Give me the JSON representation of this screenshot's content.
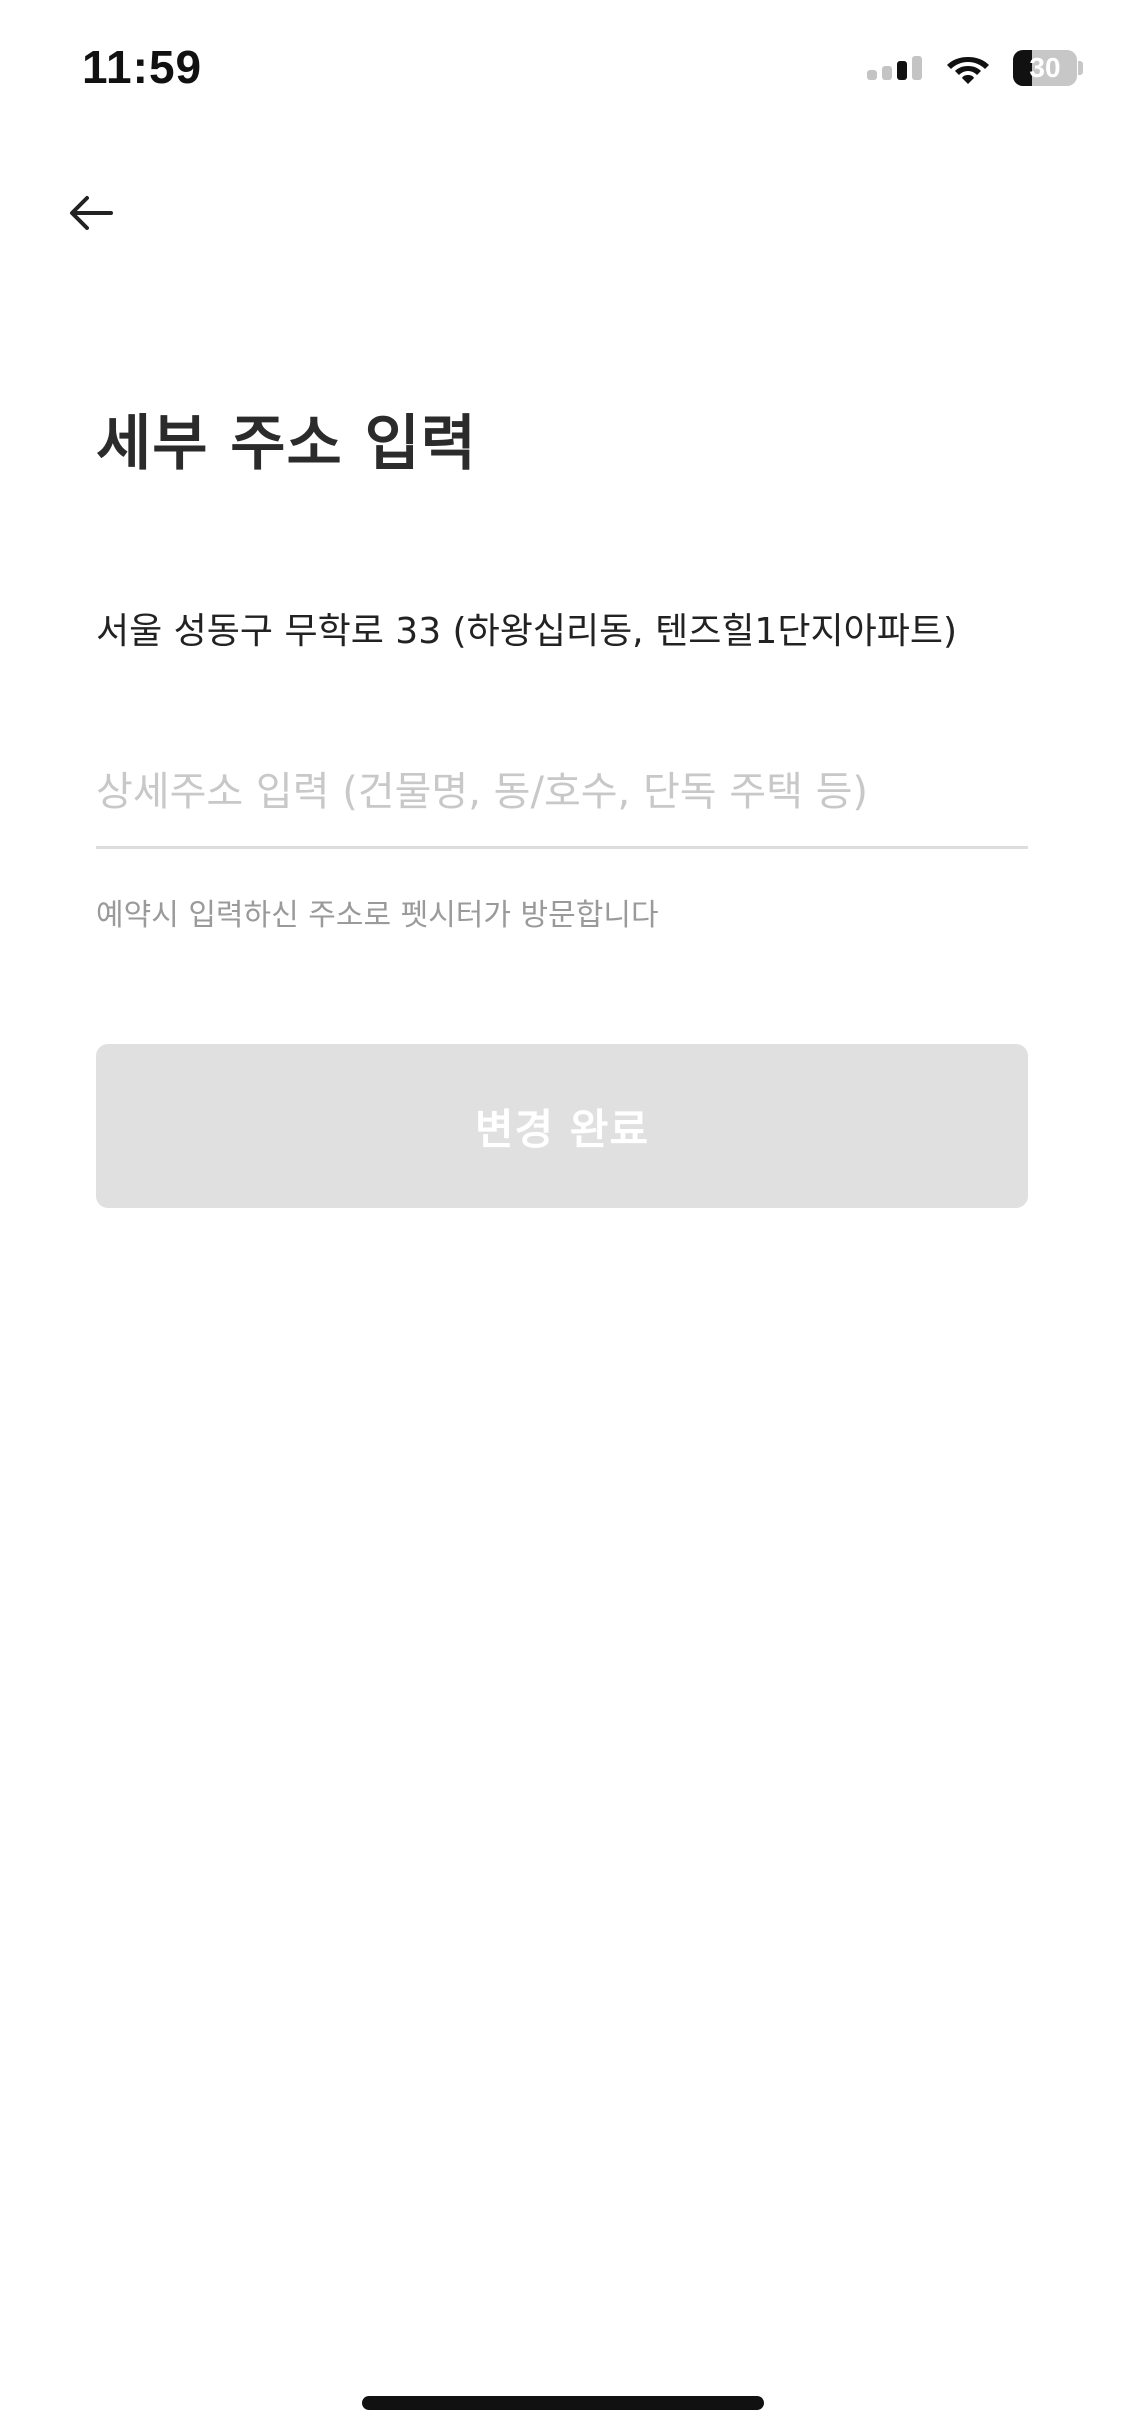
{
  "status_bar": {
    "time": "11:59",
    "battery_level": "30",
    "battery_fraction": 0.3,
    "signal_icon": "cellular-signal-icon",
    "wifi_icon": "wifi-icon"
  },
  "header": {
    "back_icon": "arrow-left-icon"
  },
  "main": {
    "title": "세부 주소 입력",
    "base_address": "서울 성동구 무학로 33 (하왕십리동, 텐즈힐1단지아파트)",
    "detail_input": {
      "value": "",
      "placeholder": "상세주소 입력 (건물명, 동/호수, 단독 주택 등)"
    },
    "helper_text": "예약시 입력하신 주소로 펫시터가 방문합니다",
    "submit_label": "변경 완료"
  },
  "colors": {
    "button_disabled_bg": "#e0e0e0",
    "button_text": "#ffffff",
    "placeholder": "#c8c8c8",
    "helper": "#9a9a9a",
    "divider": "#dddddd"
  }
}
